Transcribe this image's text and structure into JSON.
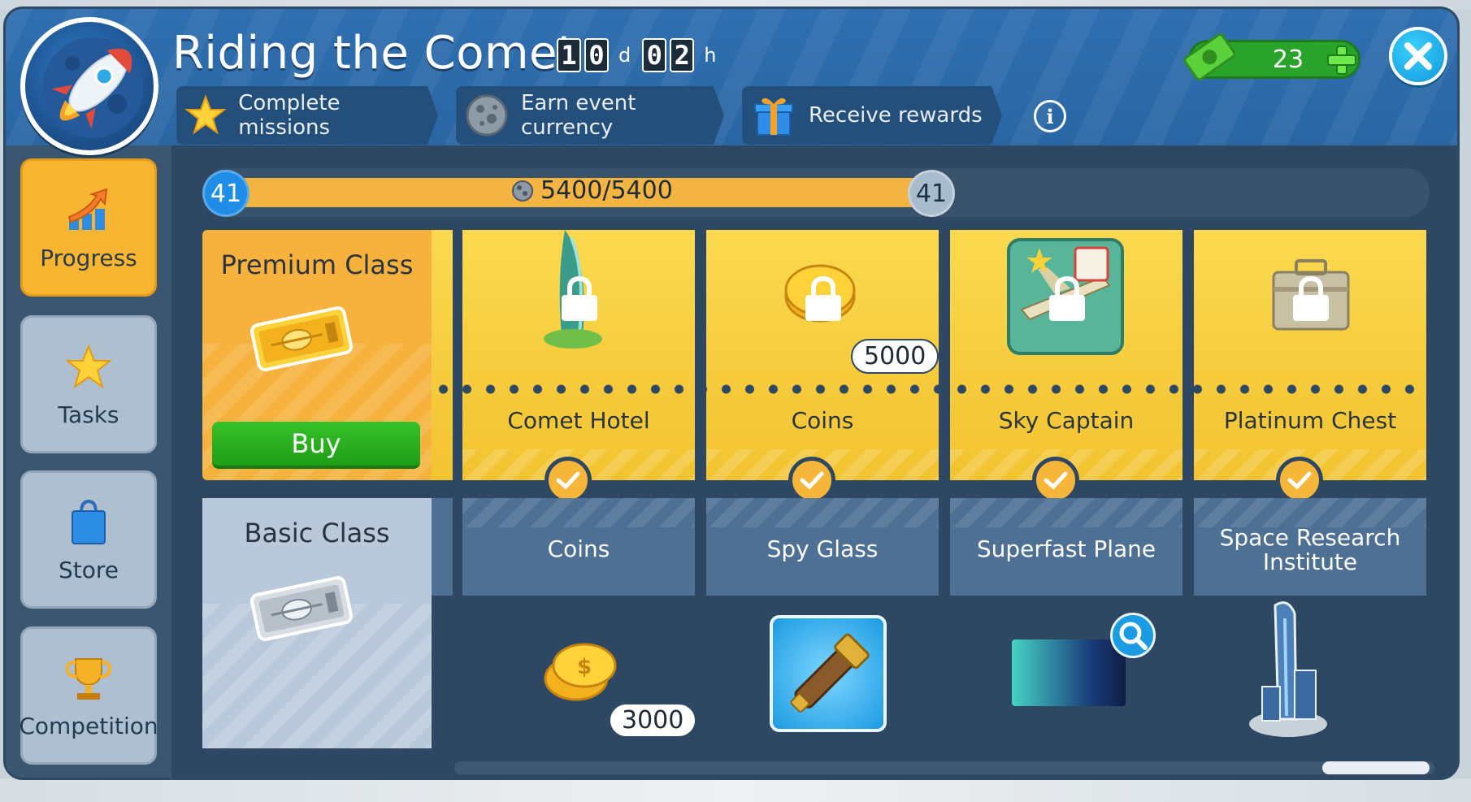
{
  "event": {
    "title": "Riding the Comet",
    "timer": {
      "days_digits": [
        "1",
        "0"
      ],
      "days_unit": "d",
      "hours_digits": [
        "0",
        "2"
      ],
      "hours_unit": "h"
    }
  },
  "steps": [
    {
      "label": "Complete missions",
      "icon": "star-icon"
    },
    {
      "label": "Earn event currency",
      "icon": "meteor-rock-icon"
    },
    {
      "label": "Receive rewards",
      "icon": "gift-icon"
    }
  ],
  "currency": {
    "value": "23",
    "icon": "cash-icon"
  },
  "sidebar": {
    "items": [
      {
        "label": "Progress",
        "icon": "progress-arrow-icon",
        "active": true
      },
      {
        "label": "Tasks",
        "icon": "star-icon",
        "active": false
      },
      {
        "label": "Store",
        "icon": "shopping-bag-icon",
        "active": false
      },
      {
        "label": "Competition",
        "icon": "trophy-icon",
        "active": false
      }
    ]
  },
  "progress": {
    "level_left": "41",
    "level_right": "41",
    "points_text": "5400/5400",
    "fill_fraction": 1.0
  },
  "premium": {
    "title": "Premium Class",
    "buy_label": "Buy",
    "rewards": [
      {
        "label": "Comet Hotel",
        "locked": true,
        "claimed": true
      },
      {
        "label": "Coins",
        "amount": "5000",
        "locked": true,
        "claimed": true
      },
      {
        "label": "Sky Captain",
        "locked": true,
        "claimed": true
      },
      {
        "label": "Platinum Chest",
        "locked": true,
        "claimed": true
      }
    ]
  },
  "basic": {
    "title": "Basic Class",
    "rewards": [
      {
        "label": "Coins",
        "amount": "3000"
      },
      {
        "label": "Spy Glass"
      },
      {
        "label": "Superfast Plane"
      },
      {
        "label_line1": "Space Research",
        "label_line2": "Institute"
      }
    ]
  },
  "colors": {
    "header_blue": "#2f6fb0",
    "premium_gold": "#f6b23c",
    "basic_blue": "#4d7094",
    "buy_green": "#1f9e16",
    "level_blue": "#1f8ce6"
  }
}
